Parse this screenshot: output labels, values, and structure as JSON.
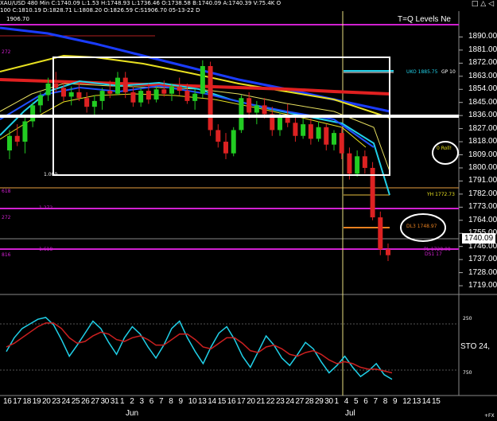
{
  "header": {
    "line1": "XAU/USD 480 Min C:1740.09 L:1.53 H:1748.93 L:1736.46 O:1738.58 B:1740.09 A:1740.39 V:75.4K O",
    "line2": "100 C:1810.19 D:1828.71 L:1808.20 O:1826.59 C:S1906.70 05-13-22 D",
    "top_price_tag": "1906.70",
    "window_icons": "□ △ ◁"
  },
  "chart_title": "T=Q Levels Ne",
  "price_axis": {
    "labels": [
      "1890.00",
      "1881.00",
      "1872.00",
      "1863.00",
      "1854.00",
      "1845.00",
      "1836.00",
      "1827.00",
      "1818.00",
      "1809.00",
      "1800.00",
      "1791.00",
      "1782.00",
      "1773.00",
      "1764.00",
      "1755.00",
      "1746.00",
      "1737.00",
      "1728.00",
      "1719.00"
    ],
    "current_price": "1740.09"
  },
  "annotations": {
    "level_1885": "UKO 1885.75",
    "gp_label": "GP 10",
    "yh_label": "YH 1772.73",
    "dl3_label": "DL3 1748.97",
    "circle_label": "0 Roll!",
    "level_1272": "1.272",
    "level_1618": "1.618",
    "level_272": "272",
    "level_618": "618",
    "level_1000": "1.000",
    "level_816": "816",
    "low_label": "DS1 17",
    "right_level": "PL 1728.08"
  },
  "oscillator": {
    "label": "STO 24,",
    "level_high": "250",
    "level_low": "750"
  },
  "time_axis": {
    "labels": [
      "16",
      "17",
      "18",
      "19",
      "20",
      "23",
      "24",
      "25",
      "26",
      "27",
      "30",
      "31",
      "1",
      "2",
      "3",
      "6",
      "7",
      "8",
      "9",
      "10",
      "13",
      "14",
      "15",
      "16",
      "17",
      "20",
      "21",
      "22",
      "23",
      "24",
      "27",
      "28",
      "29",
      "30",
      "1",
      "4",
      "5",
      "6",
      "7",
      "8",
      "9",
      "12",
      "13",
      "14",
      "15"
    ],
    "months": [
      "Jun",
      "Jul"
    ],
    "corner_mark": "+FX"
  },
  "colors": {
    "background": "#000000",
    "blue_ma": "#1a3cff",
    "yellow_ma": "#e8e020",
    "red_ma": "#e02020",
    "cyan": "#20d0e8",
    "magenta": "#d020d0",
    "bull_candle": "#22cc22",
    "bear_candle": "#dd2222"
  },
  "chart_data": {
    "type": "candlestick",
    "title": "T=Q Levels Ne",
    "ylim": [
      1713,
      1910
    ],
    "candles": [
      [
        1812,
        1826,
        1806,
        1822
      ],
      [
        1822,
        1830,
        1815,
        1818
      ],
      [
        1818,
        1835,
        1810,
        1832
      ],
      [
        1832,
        1845,
        1828,
        1843
      ],
      [
        1843,
        1852,
        1838,
        1850
      ],
      [
        1850,
        1862,
        1846,
        1858
      ],
      [
        1858,
        1866,
        1852,
        1855
      ],
      [
        1855,
        1860,
        1846,
        1849
      ],
      [
        1849,
        1856,
        1843,
        1852
      ],
      [
        1852,
        1858,
        1846,
        1848
      ],
      [
        1848,
        1852,
        1838,
        1842
      ],
      [
        1842,
        1850,
        1836,
        1846
      ],
      [
        1846,
        1855,
        1840,
        1853
      ],
      [
        1853,
        1860,
        1848,
        1851
      ],
      [
        1851,
        1866,
        1850,
        1862
      ],
      [
        1862,
        1866,
        1848,
        1852
      ],
      [
        1852,
        1856,
        1842,
        1845
      ],
      [
        1845,
        1855,
        1842,
        1853
      ],
      [
        1853,
        1858,
        1844,
        1847
      ],
      [
        1847,
        1856,
        1845,
        1854
      ],
      [
        1854,
        1860,
        1849,
        1851
      ],
      [
        1851,
        1858,
        1846,
        1856
      ],
      [
        1856,
        1862,
        1850,
        1853
      ],
      [
        1853,
        1858,
        1844,
        1846
      ],
      [
        1846,
        1854,
        1840,
        1851
      ],
      [
        1851,
        1874,
        1848,
        1870
      ],
      [
        1870,
        1873,
        1822,
        1826
      ],
      [
        1826,
        1830,
        1814,
        1818
      ],
      [
        1818,
        1824,
        1806,
        1810
      ],
      [
        1810,
        1828,
        1808,
        1826
      ],
      [
        1826,
        1850,
        1824,
        1848
      ],
      [
        1848,
        1852,
        1834,
        1838
      ],
      [
        1838,
        1846,
        1830,
        1843
      ],
      [
        1843,
        1848,
        1834,
        1837
      ],
      [
        1837,
        1842,
        1822,
        1826
      ],
      [
        1826,
        1838,
        1822,
        1835
      ],
      [
        1835,
        1844,
        1828,
        1831
      ],
      [
        1831,
        1836,
        1818,
        1822
      ],
      [
        1822,
        1834,
        1820,
        1830
      ],
      [
        1830,
        1834,
        1816,
        1820
      ],
      [
        1820,
        1832,
        1818,
        1828
      ],
      [
        1828,
        1830,
        1812,
        1816
      ],
      [
        1816,
        1826,
        1812,
        1824
      ],
      [
        1824,
        1828,
        1806,
        1810
      ],
      [
        1810,
        1814,
        1792,
        1796
      ],
      [
        1796,
        1812,
        1794,
        1808
      ],
      [
        1808,
        1812,
        1796,
        1800
      ],
      [
        1800,
        1804,
        1764,
        1766
      ],
      [
        1766,
        1770,
        1740,
        1744
      ],
      [
        1744,
        1748,
        1736,
        1740
      ]
    ],
    "oscillator_main": [
      55,
      40,
      30,
      25,
      20,
      18,
      26,
      42,
      60,
      48,
      35,
      22,
      30,
      45,
      58,
      40,
      28,
      36,
      50,
      62,
      48,
      30,
      22,
      40,
      55,
      68,
      50,
      35,
      28,
      42,
      60,
      72,
      55,
      38,
      48,
      62,
      70,
      58,
      45,
      52,
      66,
      78,
      70,
      60,
      72,
      82,
      76,
      68,
      80,
      85
    ],
    "oscillator_signal": [
      50,
      46,
      40,
      34,
      28,
      24,
      24,
      30,
      40,
      46,
      44,
      38,
      34,
      36,
      42,
      44,
      40,
      38,
      42,
      48,
      48,
      42,
      36,
      36,
      42,
      50,
      52,
      46,
      40,
      40,
      46,
      54,
      56,
      50,
      48,
      52,
      58,
      60,
      56,
      54,
      58,
      64,
      68,
      66,
      68,
      72,
      74,
      74,
      76,
      78
    ]
  }
}
